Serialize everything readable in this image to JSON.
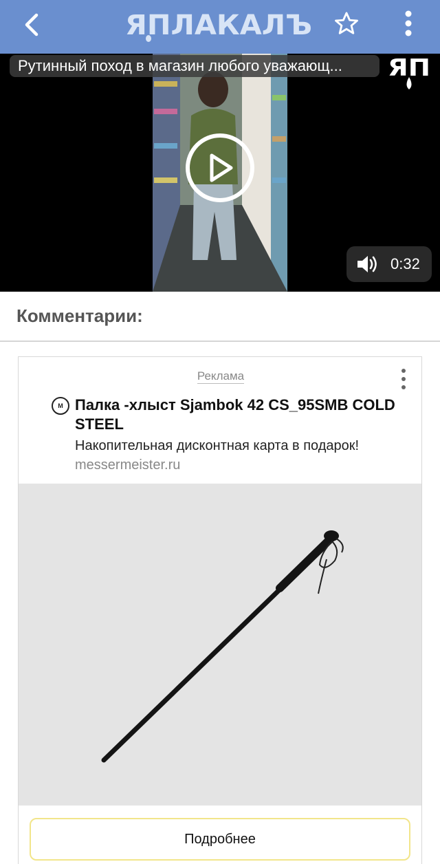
{
  "appbar": {
    "logo_text": "ЯПЛАКАЛЪ",
    "back_icon": "chevron-left-icon",
    "star_icon": "star-outline-icon",
    "more_icon": "more-vertical-icon",
    "bg_color": "#6a8fcf"
  },
  "video": {
    "title": "Рутинный поход в магазин любого уважающ...",
    "watermark": "ЯП",
    "duration": "0:32",
    "volume_icon": "volume-icon",
    "play_icon": "play-icon"
  },
  "comments": {
    "heading": "Комментарии:"
  },
  "ad": {
    "label": "Реклама",
    "favicon_text": "M",
    "headline": "Палка -хлыст Sjambok 42 CS_95SMB COLD STEEL",
    "description": "Накопительная дисконтная карта в подарок!",
    "domain": "messermeister.ru",
    "cta": "Подробнее",
    "cta_border_color": "#f2e58a"
  }
}
